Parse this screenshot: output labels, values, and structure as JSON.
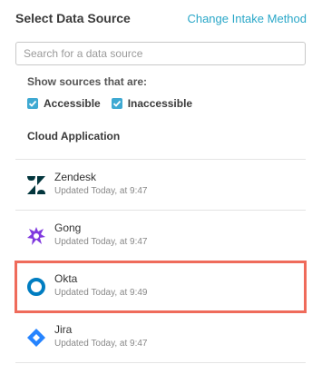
{
  "header": {
    "title": "Select Data Source",
    "change_link": "Change Intake Method"
  },
  "search": {
    "placeholder": "Search for a data source",
    "value": ""
  },
  "filter": {
    "label": "Show sources that are:",
    "options": [
      {
        "label": "Accessible",
        "checked": true
      },
      {
        "label": "Inaccessible",
        "checked": true
      }
    ]
  },
  "section_title": "Cloud Application",
  "sources": [
    {
      "name": "Zendesk",
      "updated": "Updated Today, at 9:47",
      "icon": "zendesk-logo"
    },
    {
      "name": "Gong",
      "updated": "Updated Today, at 9:47",
      "icon": "gong-logo"
    },
    {
      "name": "Okta",
      "updated": "Updated Today, at 9:49",
      "icon": "okta-logo",
      "selected": true
    },
    {
      "name": "Jira",
      "updated": "Updated Today, at 9:47",
      "icon": "jira-logo"
    }
  ],
  "colors": {
    "accent": "#2aa7c8",
    "checkbox": "#3fa9d2",
    "highlight": "#ef6b5b",
    "zendesk": "#03363d",
    "gong": "#8039df",
    "okta": "#007dc1",
    "jira": "#2684ff"
  }
}
